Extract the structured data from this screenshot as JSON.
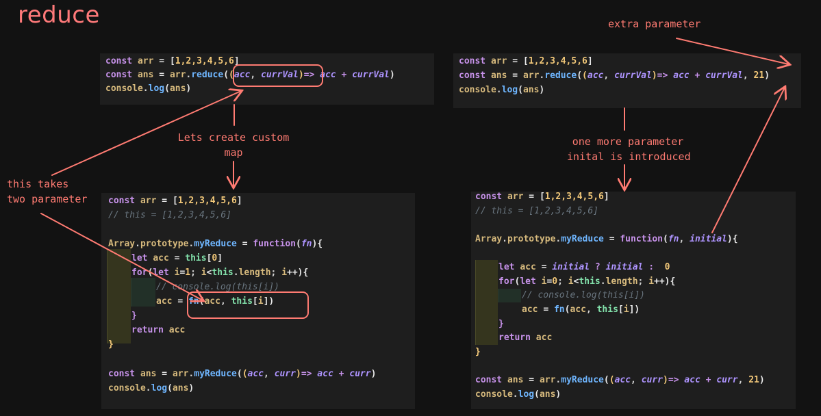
{
  "title": "reduce",
  "notes": {
    "extra_parameter": "extra parameter",
    "custom_map_line1": "Lets create custom",
    "custom_map_line2": "map",
    "one_more_line1": "one more parameter",
    "one_more_line2": "inital is introduced",
    "two_param_line1": "this takes",
    "two_param_line2": "two parameter"
  },
  "blocks": {
    "top_left": {
      "lines": [
        "const arr = [1,2,3,4,5,6]",
        "const ans = arr.reduce((acc, currVal)=> acc + currVal)",
        "console.log(ans)"
      ]
    },
    "top_right": {
      "lines": [
        "const arr = [1,2,3,4,5,6]",
        "const ans = arr.reduce((acc, currVal)=> acc + currVal, 21)",
        "console.log(ans)"
      ]
    },
    "bottom_left": {
      "lines": [
        "const arr = [1,2,3,4,5,6]",
        "// this = [1,2,3,4,5,6]",
        "",
        "Array.prototype.myReduce = function(fn){",
        "    let acc = this[0]",
        "    for(let i=1; i<this.length; i++){",
        "        // console.log(this[i])",
        "        acc = fn(acc, this[i])",
        "    }",
        "    return acc",
        "}",
        "",
        "const ans = arr.myReduce((acc, curr)=> acc + curr)",
        "console.log(ans)"
      ]
    },
    "bottom_right": {
      "lines": [
        "const arr = [1,2,3,4,5,6]",
        "// this = [1,2,3,4,5,6]",
        "",
        "Array.prototype.myReduce = function(fn, initial){",
        "",
        "    let acc = initial ? initial :  0",
        "    for(let i=0; i<this.length; i++){",
        "        // console.log(this[i])",
        "        acc = fn(acc, this[i])",
        "    }",
        "    return acc",
        "}",
        "",
        "const ans = arr.myReduce((acc, curr)=> acc + curr, 21)",
        "console.log(ans)"
      ]
    }
  },
  "colors": {
    "annotation": "#ff7b72",
    "background": "#121212",
    "editor": "#1e1e1e"
  }
}
